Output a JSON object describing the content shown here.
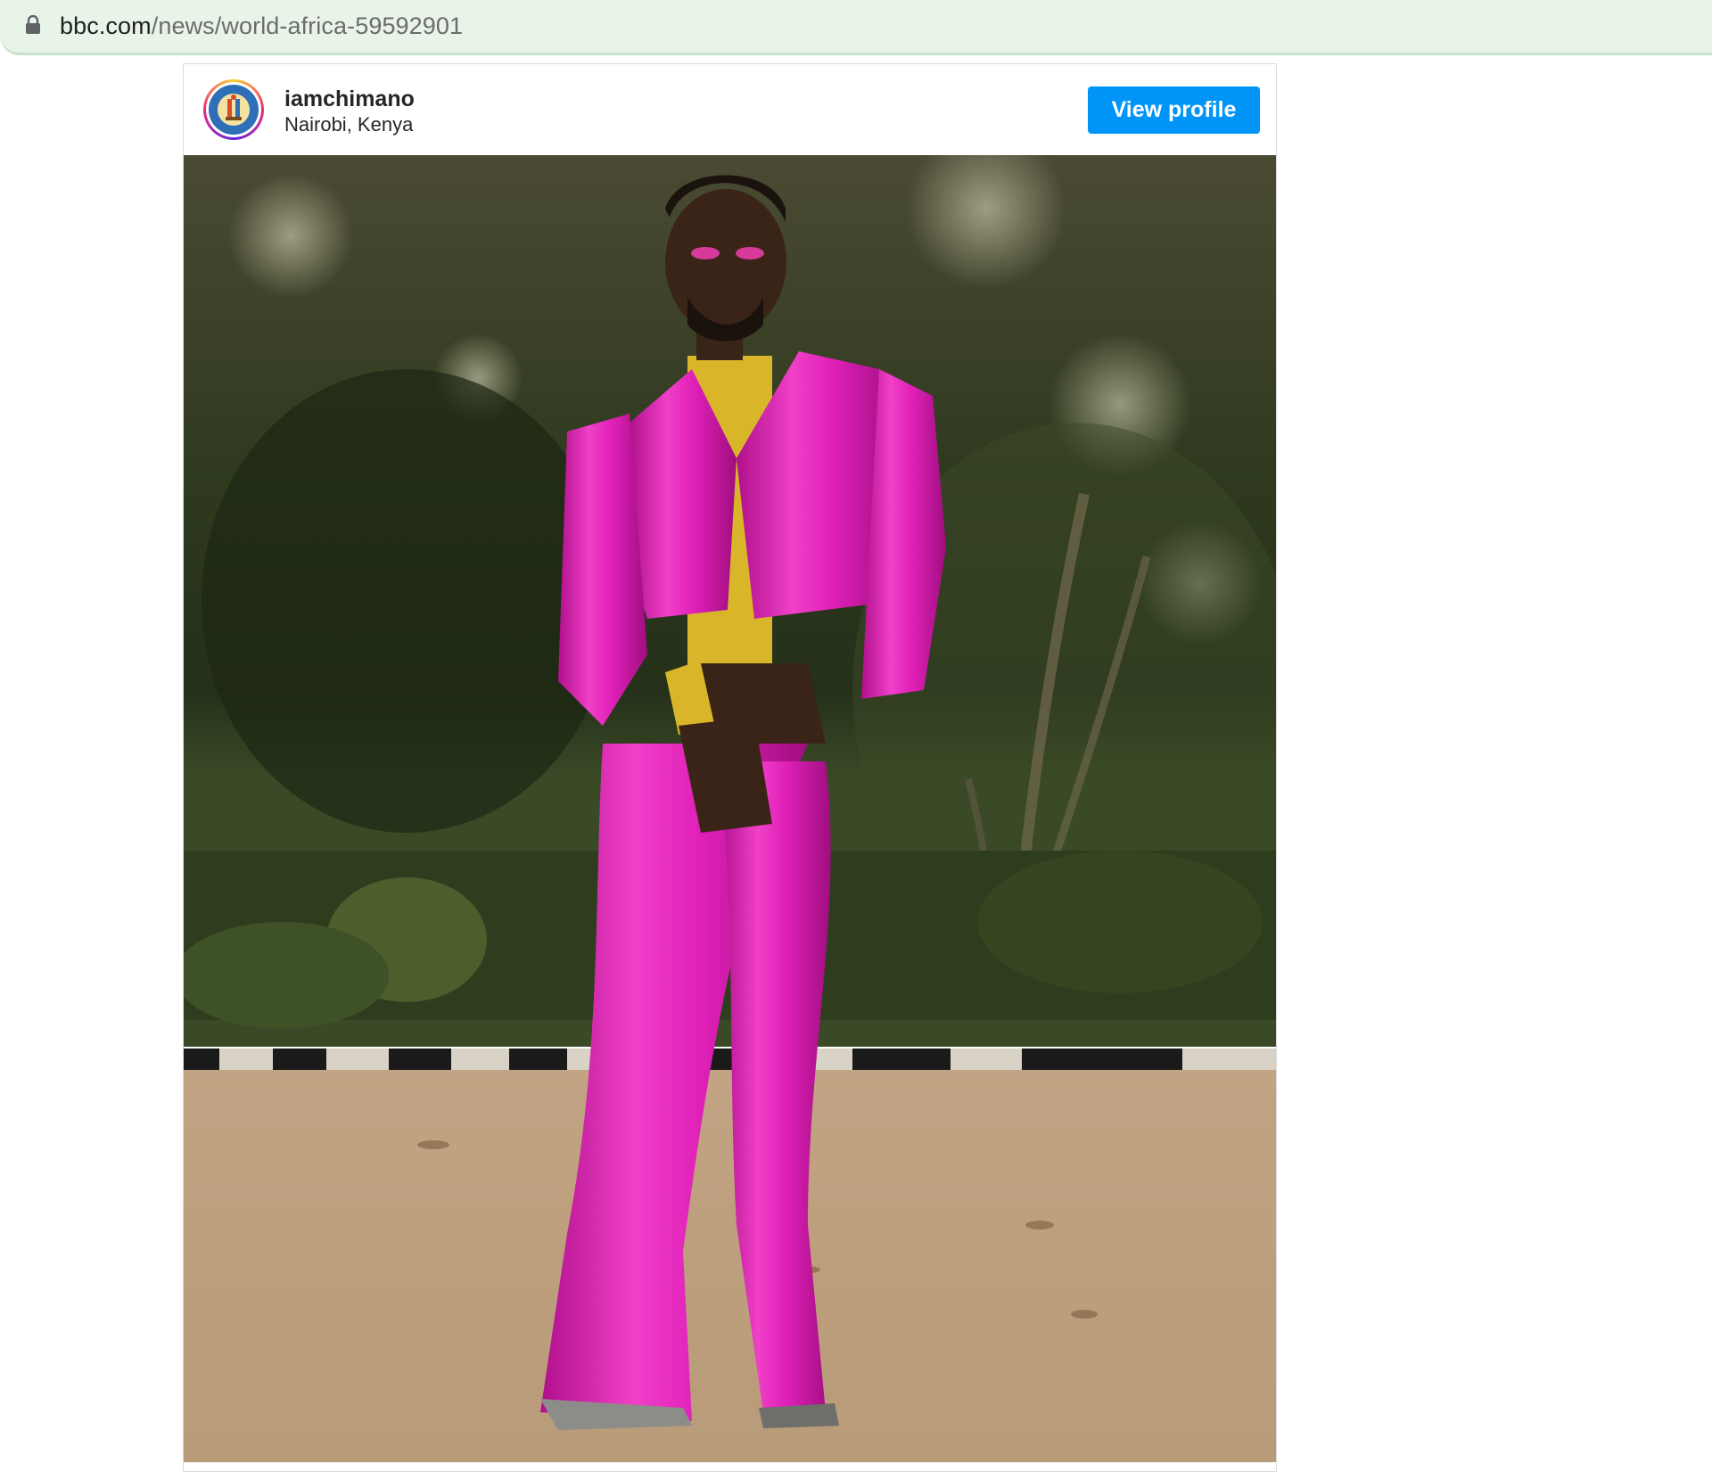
{
  "browser": {
    "url_domain": "bbc.com",
    "url_path": "/news/world-africa-59592901",
    "lock_icon": "lock-icon",
    "bar_color": "#e9f4e9"
  },
  "embed": {
    "username": "iamchimano",
    "location": "Nairobi, Kenya",
    "view_profile_label": "View profile",
    "button_color": "#0095f6",
    "avatar_icon": "profile-avatar-icon"
  },
  "photo": {
    "icon": "post-photo-image",
    "colors": {
      "suit": "#e020b8",
      "shirt": "#d9b52a",
      "foliage": "#2f3a1e",
      "pavement": "#b89b78"
    }
  }
}
